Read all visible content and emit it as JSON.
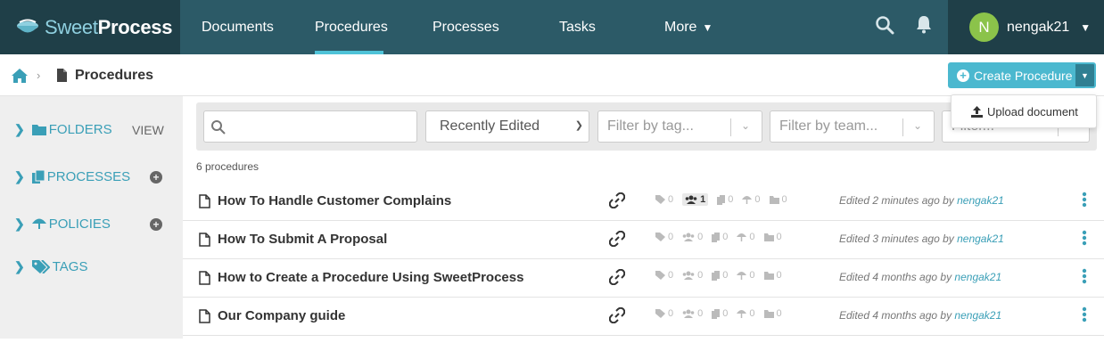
{
  "brand": {
    "name_light": "Sweet",
    "name_bold": "Process"
  },
  "nav": {
    "items": [
      "Documents",
      "Procedures",
      "Processes",
      "Tasks",
      "More"
    ],
    "active": "Procedures"
  },
  "user": {
    "initial": "N",
    "name": "nengak21"
  },
  "breadcrumb": {
    "title": "Procedures"
  },
  "create": {
    "label": "Create Procedure",
    "dropdown_item": "Upload document"
  },
  "sidebar": {
    "folders": "FOLDERS",
    "folders_action": "VIEW",
    "processes": "PROCESSES",
    "policies": "POLICIES",
    "tags": "TAGS"
  },
  "filters": {
    "search_placeholder": "",
    "sort": "Recently Edited",
    "tag_placeholder": "Filter by tag...",
    "team_placeholder": "Filter by team...",
    "status_placeholder": "Filter..."
  },
  "count_label": "6 procedures",
  "procedures": [
    {
      "title": "How To Handle Customer Complains",
      "tags": "0",
      "teams": "1",
      "processes": "0",
      "policies": "0",
      "folders": "0",
      "edited_prefix": "Edited 2 minutes ago by ",
      "user": "nengak21"
    },
    {
      "title": "How To Submit A Proposal",
      "tags": "0",
      "teams": "0",
      "processes": "0",
      "policies": "0",
      "folders": "0",
      "edited_prefix": "Edited 3 minutes ago by ",
      "user": "nengak21"
    },
    {
      "title": "How to Create a Procedure Using SweetProcess",
      "tags": "0",
      "teams": "0",
      "processes": "0",
      "policies": "0",
      "folders": "0",
      "edited_prefix": "Edited 4 months ago by ",
      "user": "nengak21"
    },
    {
      "title": "Our Company guide",
      "tags": "0",
      "teams": "0",
      "processes": "0",
      "policies": "0",
      "folders": "0",
      "edited_prefix": "Edited 4 months ago by ",
      "user": "nengak21"
    }
  ],
  "colors": {
    "nav_bg": "#2c5a67",
    "accent": "#4bb8cf",
    "link": "#3a9fb7",
    "avatar": "#8bc34a"
  }
}
